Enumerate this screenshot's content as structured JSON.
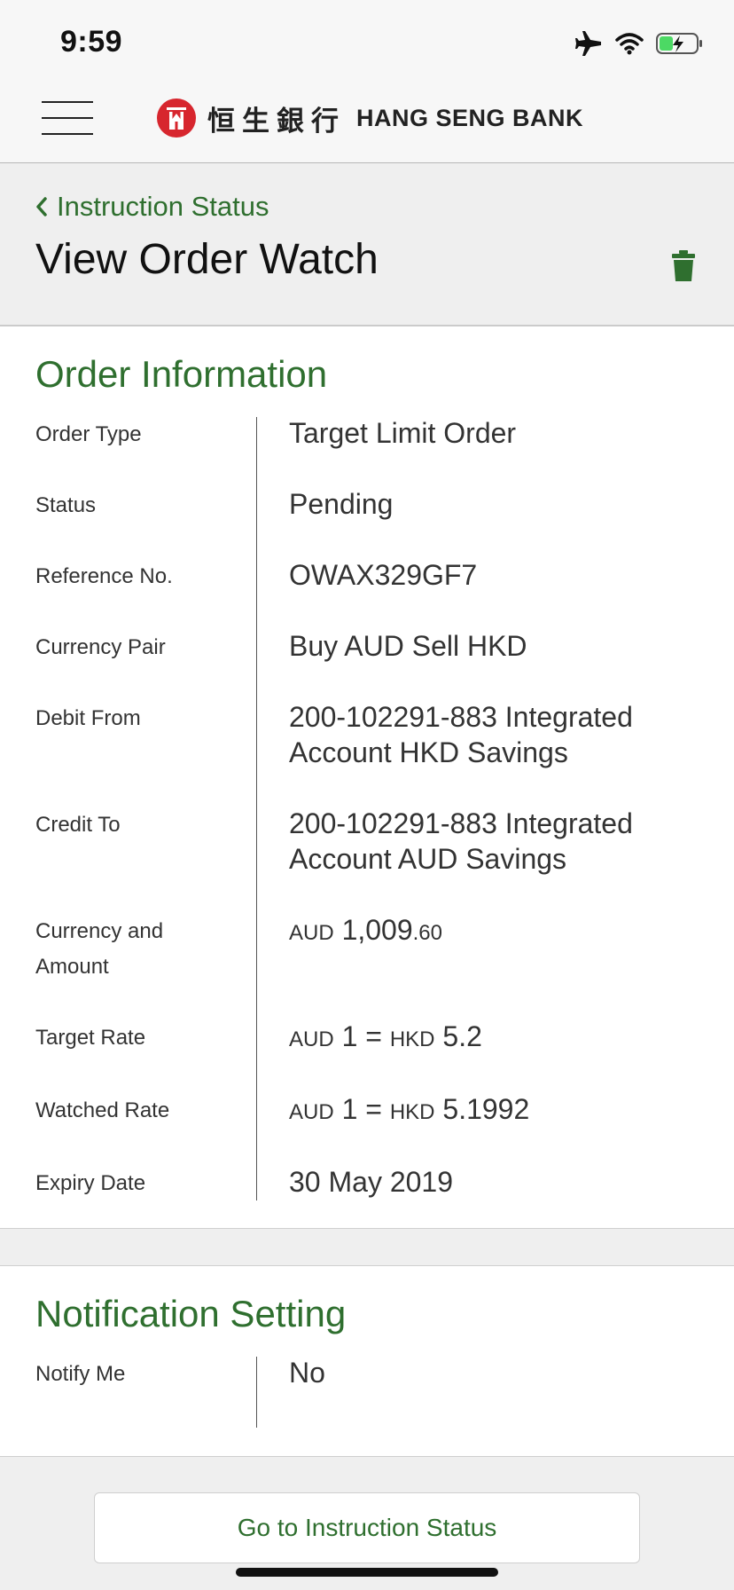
{
  "status_bar": {
    "time": "9:59"
  },
  "header": {
    "brand_cn": "恒生銀行",
    "brand_en": "HANG SENG BANK",
    "brand_color": "#d7262e"
  },
  "breadcrumb": {
    "back_label": "Instruction Status"
  },
  "page": {
    "title": "View Order Watch"
  },
  "order_info": {
    "title": "Order Information",
    "rows": [
      {
        "label": "Order Type",
        "value": "Target Limit Order"
      },
      {
        "label": "Status",
        "value": "Pending"
      },
      {
        "label": "Reference No.",
        "value": "OWAX329GF7"
      },
      {
        "label": "Currency Pair",
        "value": "Buy AUD Sell HKD"
      },
      {
        "label": "Debit From",
        "value_line1": "200-102291-883 Integrated",
        "value_line2": "Account HKD Savings"
      },
      {
        "label": "Credit To",
        "value_line1": "200-102291-883 Integrated",
        "value_line2": "Account AUD Savings"
      },
      {
        "label_line1": "Currency and",
        "label_line2": "Amount",
        "currency": "AUD",
        "amount_int": "1,009",
        "amount_dec": ".60"
      },
      {
        "label": "Target Rate",
        "cur1": "AUD",
        "num1": "1 =",
        "cur2": "HKD",
        "num2": "5.2"
      },
      {
        "label": "Watched Rate",
        "cur1": "AUD",
        "num1": "1 =",
        "cur2": "HKD",
        "num2": "5.1992"
      },
      {
        "label": "Expiry Date",
        "value": "30 May 2019"
      }
    ]
  },
  "notification": {
    "title": "Notification Setting",
    "rows": [
      {
        "label": "Notify Me",
        "value": "No"
      }
    ]
  },
  "footer": {
    "button_label": "Go to Instruction Status"
  },
  "colors": {
    "accent": "#2f6f2f",
    "battery_charge": "#4cd964"
  }
}
